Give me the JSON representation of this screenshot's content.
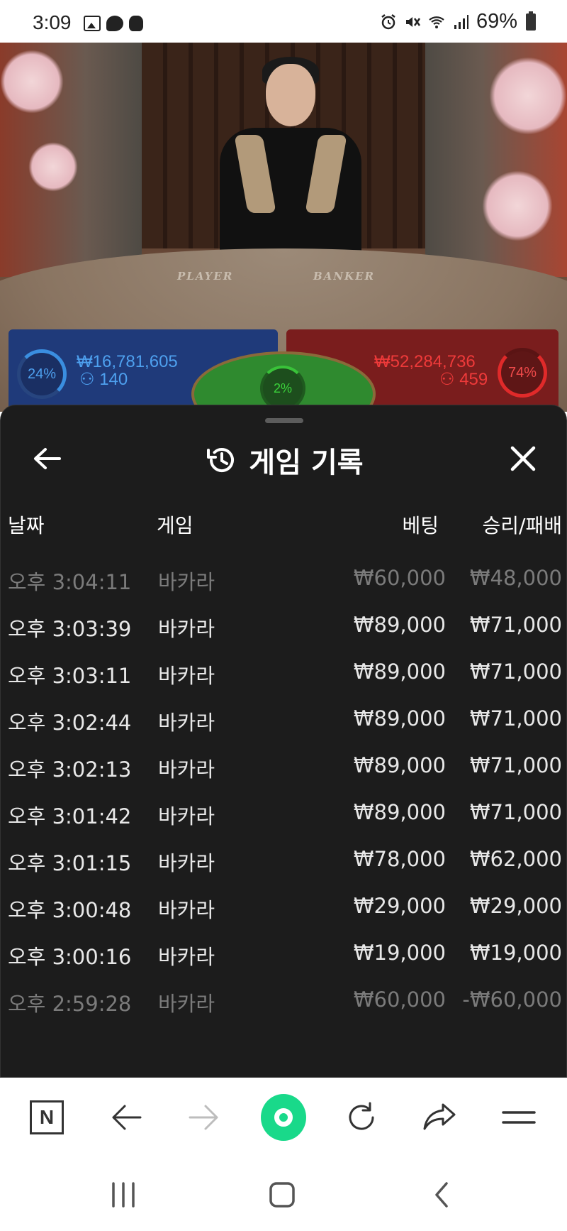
{
  "status_bar": {
    "time": "3:09",
    "battery": "69%",
    "left_icons": [
      "gallery-icon",
      "chat-icon",
      "game-icon"
    ],
    "right_icons": [
      "alarm-icon",
      "mute-icon",
      "wifi-icon",
      "signal-icon",
      "battery-icon"
    ]
  },
  "video": {
    "table_labels": {
      "player": "PLAYER",
      "banker": "BANKER"
    },
    "player": {
      "percent": "24%",
      "amount": "₩16,781,605",
      "count": "140",
      "color": "#3a8ee0"
    },
    "tie": {
      "percent": "2%",
      "color": "#39c239"
    },
    "banker": {
      "percent": "74%",
      "amount": "₩52,284,736",
      "count": "459",
      "color": "#e02a2a"
    }
  },
  "panel": {
    "title": "게임 기록",
    "icons": {
      "back": "arrow-left-icon",
      "history": "history-icon",
      "close": "close-icon"
    },
    "columns": {
      "date": "날짜",
      "game": "게임",
      "bet": "베팅",
      "result": "승리/패배"
    },
    "rows": [
      {
        "date": "오후 3:04:11",
        "game": "바카라",
        "bet": "₩60,000",
        "result": "₩48,000",
        "faded": true
      },
      {
        "date": "오후 3:03:39",
        "game": "바카라",
        "bet": "₩89,000",
        "result": "₩71,000",
        "faded": false
      },
      {
        "date": "오후 3:03:11",
        "game": "바카라",
        "bet": "₩89,000",
        "result": "₩71,000",
        "faded": false
      },
      {
        "date": "오후 3:02:44",
        "game": "바카라",
        "bet": "₩89,000",
        "result": "₩71,000",
        "faded": false
      },
      {
        "date": "오후 3:02:13",
        "game": "바카라",
        "bet": "₩89,000",
        "result": "₩71,000",
        "faded": false
      },
      {
        "date": "오후 3:01:42",
        "game": "바카라",
        "bet": "₩89,000",
        "result": "₩71,000",
        "faded": false
      },
      {
        "date": "오후 3:01:15",
        "game": "바카라",
        "bet": "₩78,000",
        "result": "₩62,000",
        "faded": false
      },
      {
        "date": "오후 3:00:48",
        "game": "바카라",
        "bet": "₩29,000",
        "result": "₩29,000",
        "faded": false
      },
      {
        "date": "오후 3:00:16",
        "game": "바카라",
        "bet": "₩19,000",
        "result": "₩19,000",
        "faded": false
      },
      {
        "date": "오후 2:59:28",
        "game": "바카라",
        "bet": "₩60,000",
        "result": "-₩60,000",
        "faded": true
      }
    ]
  },
  "browser_toolbar": {
    "logo_letter": "N",
    "home_color": "#19d98a",
    "icons": [
      "naver-icon",
      "back-arrow-icon",
      "forward-arrow-icon",
      "home-icon",
      "reload-icon",
      "share-icon",
      "menu-icon"
    ]
  },
  "nav_bar": {
    "icons": [
      "recents-icon",
      "home-square-icon",
      "back-chevron-icon"
    ]
  }
}
